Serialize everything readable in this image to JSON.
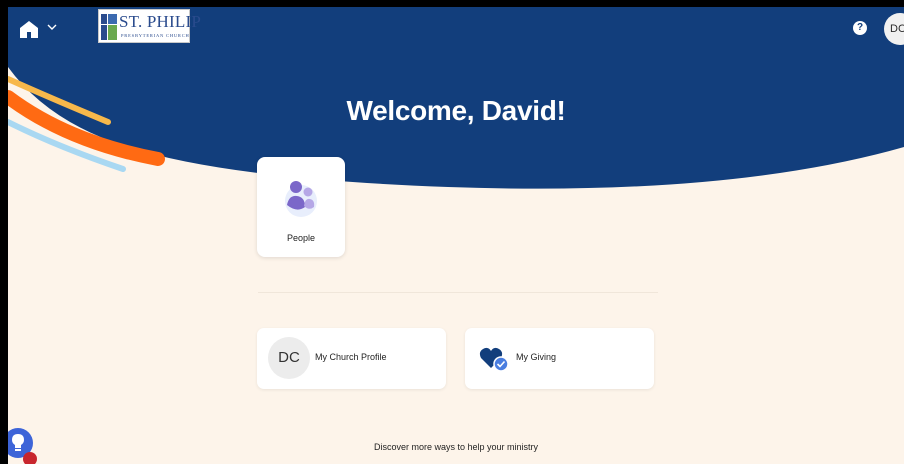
{
  "header": {
    "home_icon": "home-icon",
    "chevron_icon": "chevron-down-icon",
    "logo": {
      "title": "ST. PHILIP",
      "subtitle": "PRESBYTERIAN CHURCH"
    },
    "help_label": "?",
    "avatar_initials": "DC"
  },
  "hero": {
    "welcome": "Welcome, David!",
    "colors": {
      "navy": "#123e7c",
      "cream": "#fdf4ea",
      "orange": "#ff6a13",
      "gold": "#f7b84b",
      "light_blue": "#a9d8f2"
    }
  },
  "tiles": [
    {
      "label": "People",
      "icon": "people-icon"
    }
  ],
  "cards": [
    {
      "label": "My Church Profile",
      "avatar_initials": "DC"
    },
    {
      "label": "My Giving",
      "icon": "heart-check-icon"
    }
  ],
  "footer": {
    "discover": "Discover more ways to help your ministry"
  },
  "help_widget": {
    "icon": "lightbulb-icon"
  }
}
